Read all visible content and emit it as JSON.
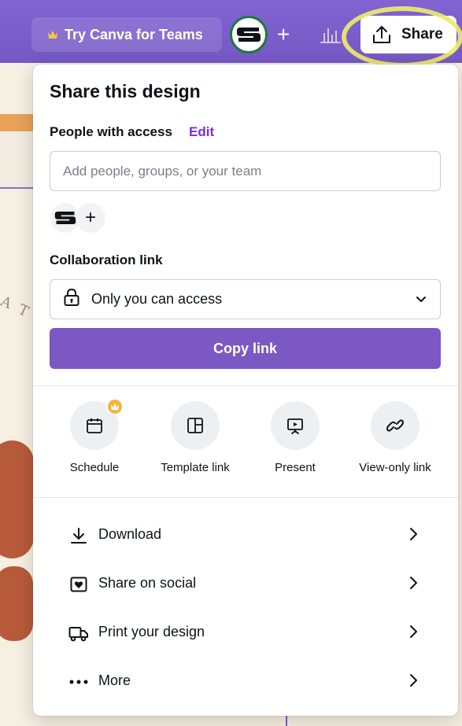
{
  "topbar": {
    "teams_label": "Try Canva for Teams",
    "avatar_letter": "S",
    "add_label": "+",
    "share_label": "Share"
  },
  "share_panel": {
    "title": "Share this design",
    "people_access_label": "People with access",
    "edit_label": "Edit",
    "people_input_placeholder": "Add people, groups, or your team",
    "member_initial": "S",
    "add_member_label": "+",
    "collab_link_label": "Collaboration link",
    "access_selected": "Only you can access",
    "copy_link_label": "Copy link",
    "quick_actions": [
      {
        "label": "Schedule",
        "icon": "calendar-icon",
        "premium": true
      },
      {
        "label": "Template link",
        "icon": "template-icon",
        "premium": false
      },
      {
        "label": "Present",
        "icon": "present-icon",
        "premium": false
      },
      {
        "label": "View-only link",
        "icon": "link-icon",
        "premium": false
      }
    ],
    "list_actions": [
      {
        "label": "Download",
        "icon": "download-icon"
      },
      {
        "label": "Share on social",
        "icon": "heart-icon"
      },
      {
        "label": "Print your design",
        "icon": "truck-icon"
      },
      {
        "label": "More",
        "icon": "more-icon"
      }
    ]
  },
  "canvas": {
    "partial_text": "A T"
  },
  "colors": {
    "topbar": "#7d5ed0",
    "accent_button": "#7b58c4",
    "edit_link": "#7d2ae8",
    "highlight": "#ecea6b",
    "premium_badge": "#f4b63b"
  }
}
